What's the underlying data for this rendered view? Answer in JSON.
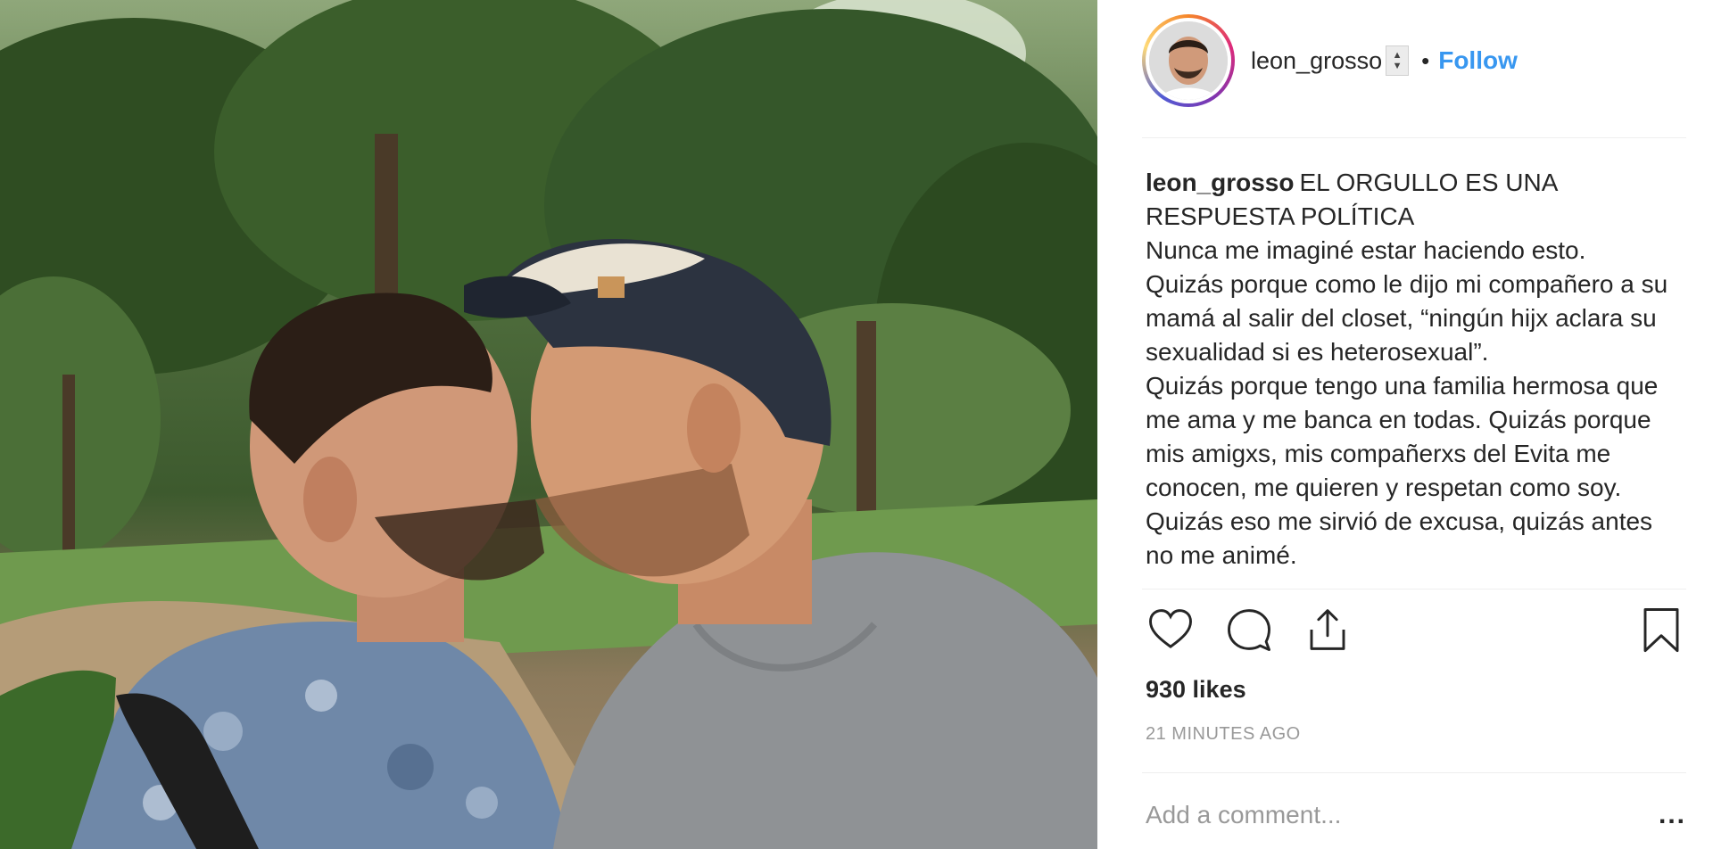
{
  "post": {
    "author": "leon_grosso",
    "follow_label": "Follow",
    "separator": "•",
    "caption_title": "EL ORGULLO ES UNA RESPUESTA POLÍTICA",
    "caption_lines": [
      "Nunca me imaginé estar haciendo esto.",
      "Quizás porque como le dijo mi compañero a su mamá al salir del closet, “ningún hijx aclara su sexualidad si es heterosexual”.",
      "Quizás porque tengo una familia hermosa que me ama y me banca en todas. Quizás porque mis amigxs, mis compañerxs del Evita me conocen, me quieren y respetan como soy.",
      "Quizás eso me sirvió de excusa, quizás antes no me animé."
    ],
    "likes": "930 likes",
    "time_ago": "21 MINUTES AGO"
  },
  "comment": {
    "placeholder": "Add a comment...",
    "more_label": "..."
  },
  "icons": {
    "like": "heart-icon",
    "comment": "comment-bubble-icon",
    "share": "share-icon",
    "save": "bookmark-icon",
    "sort": "sort-updown-icon"
  },
  "colors": {
    "link": "#3897f0",
    "text": "#262626",
    "muted": "#999999",
    "divider": "#efefef"
  }
}
